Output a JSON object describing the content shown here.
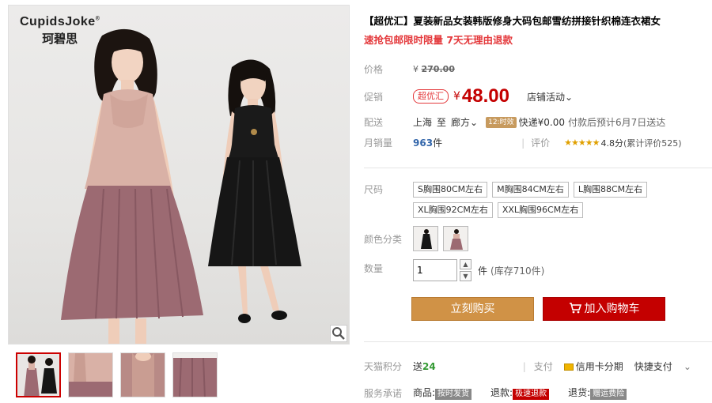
{
  "gallery": {
    "brand_en": "CupidsJoke",
    "brand_mark": "®",
    "brand_cn": "珂碧思",
    "thumb_count": 4
  },
  "product": {
    "title": "【超优汇】夏装新品女装韩版修身大码包邮雪纺拼接针织棉连衣裙女",
    "subtitle": "速抢包邮限时限量 7天无理由退款"
  },
  "price": {
    "label": "价格",
    "currency": "¥",
    "original": "270.00"
  },
  "promo": {
    "label": "促销",
    "tag": "超优汇",
    "currency": "¥",
    "price": "48.00",
    "event": "店铺活动",
    "event_arrow": "⌄"
  },
  "shipping": {
    "label": "配送",
    "from": "上海",
    "to_word": "至",
    "to": "廊方",
    "to_arrow": "⌄",
    "badge": "12:时效",
    "fee": "快递¥0.00",
    "note": "付款后预计6月7日送达"
  },
  "stats": {
    "sales_label": "月销量",
    "sales_count": "963",
    "sales_unit": "件",
    "review_label": "评价",
    "stars": "★★★★★",
    "rating": "4.8分",
    "review_count": "(累计评价525)"
  },
  "size": {
    "label": "尺码",
    "options": [
      "S胸围80CM左右",
      "M胸围84CM左右",
      "L胸围88CM左右",
      "XL胸围92CM左右",
      "XXL胸围96CM左右"
    ]
  },
  "color": {
    "label": "颜色分类"
  },
  "quantity": {
    "label": "数量",
    "value": "1",
    "up": "▲",
    "down": "▼",
    "unit": "件",
    "stock": "(库存710件)"
  },
  "actions": {
    "buy": "立刻购买",
    "cart": "加入购物车"
  },
  "points": {
    "label": "天猫积分",
    "give": "送",
    "value": "24",
    "pay_label": "支付",
    "pay_credit": "信用卡分期",
    "pay_fast": "快捷支付",
    "more": "⌄"
  },
  "service": {
    "label": "服务承诺",
    "items": [
      {
        "prefix": "商品:",
        "tag": "按时发货"
      },
      {
        "prefix": "退款:",
        "tag": "极速退款"
      },
      {
        "prefix": "退货:",
        "tag": "赠运费险"
      }
    ]
  },
  "colors": {
    "price_red": "#c40000",
    "buy_orange": "#d09246",
    "cart_red": "#c40000",
    "link_blue": "#3366aa"
  }
}
